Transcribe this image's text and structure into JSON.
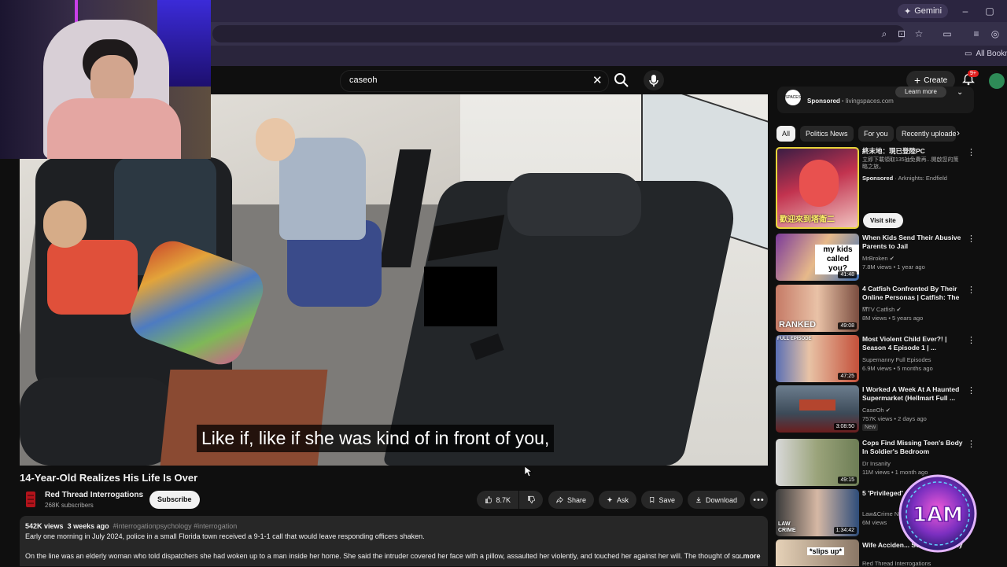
{
  "browser": {
    "gemini_label": "Gemini",
    "bookmarks_label": "All Bookm"
  },
  "header": {
    "search_value": "caseoh",
    "create_label": "Create",
    "notifications_badge": "9+"
  },
  "video": {
    "subtitle": "Like if, like if she was kind of in front of you,",
    "title": "14-Year-Old Realizes His Life Is Over"
  },
  "channel": {
    "name": "Red Thread Interrogations",
    "subscribers": "268K subscribers",
    "subscribe_label": "Subscribe"
  },
  "actions": {
    "likes": "8.7K",
    "share": "Share",
    "ask": "Ask",
    "save": "Save",
    "download": "Download"
  },
  "description": {
    "views": "542K views",
    "age": "3 weeks ago",
    "tags": "#interrogationpsychology #interrogation",
    "line1": "Early one morning in July 2024, police in a small Florida town received a 9-1-1 call that would leave responding officers shaken.",
    "line2": "On the line was an elderly woman who told dispatchers she had woken up to a man inside her home. She said the intruder covered her face with a pillow, assaulted her violently, and touched her against her will. The thought of someth",
    "more": "...more"
  },
  "sidebar": {
    "ad": {
      "icon_text": "SPACES",
      "sponsored": "Sponsored",
      "advertiser": "livingspaces.com",
      "learn_more": "Learn more"
    },
    "chips": [
      "All",
      "Politics News",
      "For you",
      "Recently uploaded"
    ],
    "recommendations": [
      {
        "title": "終末地：現已登陸PC",
        "desc": "立即下載領取135抽免費再...開啟您的策略之旅。",
        "channel": "Arknights: Endfield",
        "sponsored": "Sponsored",
        "thumb_text": "歡迎來到塔衛二",
        "visit_label": "Visit site"
      },
      {
        "title": "When Kids Send Their Abusive Parents to Jail",
        "channel": "MrBroken",
        "meta": "7.8M views • 1 year ago",
        "duration": "41:48",
        "thumb_text": "my kids called you?"
      },
      {
        "title": "4 Catfish Confronted By Their Online Personas | Catfish: The ...",
        "channel": "MTV Catfish",
        "meta": "8M views • 5 years ago",
        "duration": "49:08",
        "thumb_text": "RANKED"
      },
      {
        "title": "Most Violent Child Ever?! | Season 4 Episode 1 | ...",
        "channel": "Supernanny Full Episodes",
        "meta": "6.9M views • 5 months ago",
        "duration": "47:25",
        "thumb_text": "FULL EPISODE"
      },
      {
        "title": "I Worked A Week At A Haunted Supermarket (Hellmart Full ...",
        "channel": "CaseOh",
        "meta": "757K views • 2 days ago",
        "duration": "3:08:50",
        "badge": "New"
      },
      {
        "title": "Cops Find Missing Teen's Body In Soldier's Bedroom",
        "channel": "Dr Insanity",
        "meta": "11M views • 1 month ago",
        "duration": "49:15"
      },
      {
        "title": "5 'Privileged' ... on Bodycam",
        "channel": "Law&Crime N...",
        "meta": "6M views",
        "duration": "1:34:42",
        "thumb_text": "LAW CRIME"
      },
      {
        "title": "Wife Acciden... Something Only",
        "channel": "Red Thread Interrogations",
        "thumb_text": "*slips up*"
      }
    ]
  },
  "overlay": {
    "logo_text": "1AM"
  },
  "colors": {
    "background": "#0f0f0f",
    "chip_active": "#f1f1f1",
    "badge_red": "#e02020"
  }
}
